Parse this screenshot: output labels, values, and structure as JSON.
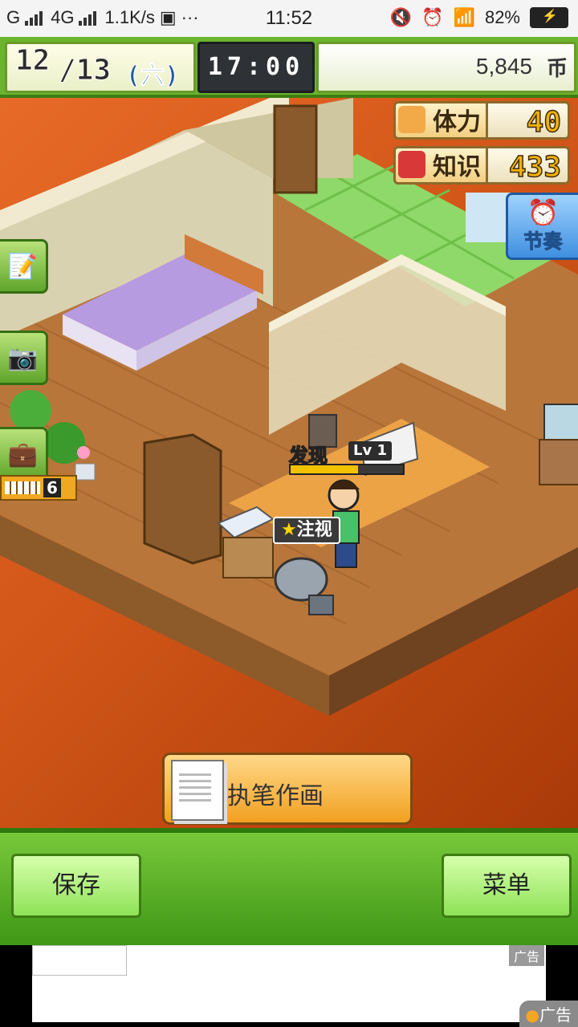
{
  "status_bar": {
    "carrier": "G",
    "network": "4G",
    "speed": "1.1K/s",
    "more": "···",
    "time": "11:52",
    "battery": "82%"
  },
  "hud": {
    "month": "12",
    "day": "/13",
    "weekday": "(六)",
    "clock": "17:00",
    "money": "5,845",
    "currency": "币"
  },
  "stats": {
    "stamina_label": "体力",
    "stamina_value": "40",
    "knowledge_label": "知识",
    "knowledge_value": "433"
  },
  "schedule_button": "节奏",
  "counter": "6",
  "character": {
    "name": "发现",
    "level_prefix": "Lv",
    "level": "1",
    "progress": 0.6,
    "badge": "注视"
  },
  "action_button": "执笔作画",
  "bottom_bar": {
    "save": "保存",
    "menu": "菜单"
  },
  "ad": {
    "tag": "广告",
    "logo": "广告"
  },
  "colors": {
    "hud_green": "#6ab42e",
    "background_orange": "#d25618",
    "button_orange": "#f2a020"
  }
}
